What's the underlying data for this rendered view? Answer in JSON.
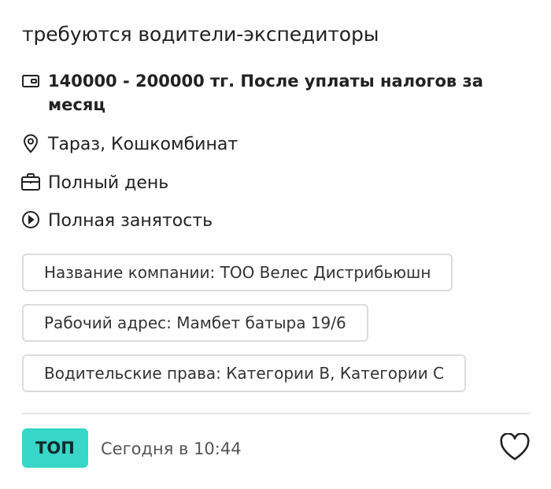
{
  "vacancy": {
    "title": "требуются водители-экспедиторы",
    "salary": "140000 - 200000 тг. После уплаты налогов за месяц",
    "location": "Тараз, Кошкомбинат",
    "schedule": "Полный день",
    "employment": "Полная занятость"
  },
  "chips": {
    "company": "Название компании: ТОО Велес Дистрибьюшн",
    "address": "Рабочий адрес: Мамбет батыра 19/6",
    "license": "Водительские права: Категории B, Категории C"
  },
  "footer": {
    "badge": "ТОП",
    "date": "Сегодня в 10:44"
  },
  "icons": {
    "salary": "wallet-icon",
    "location": "location-pin-icon",
    "schedule": "briefcase-icon",
    "employment": "clock-icon",
    "favorite": "heart-icon"
  },
  "colors": {
    "accent": "#38d6c8",
    "text": "#222222",
    "border": "#dcdcdc"
  }
}
